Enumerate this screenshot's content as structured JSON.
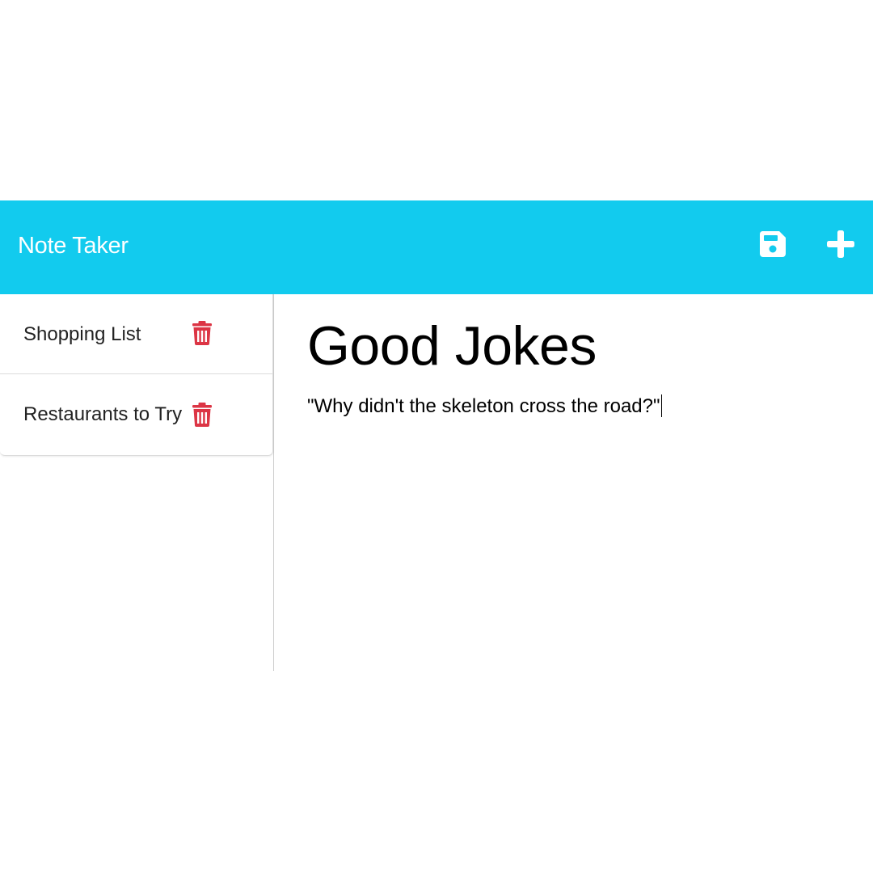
{
  "header": {
    "brand": "Note Taker",
    "save_icon": "floppy-disk-icon",
    "add_icon": "plus-icon",
    "background": "#12cbee"
  },
  "sidebar": {
    "notes": [
      {
        "title": "Shopping List",
        "delete_icon": "trash-icon"
      },
      {
        "title": "Restaurants to Try",
        "delete_icon": "trash-icon"
      }
    ],
    "delete_color": "#dc3545"
  },
  "editor": {
    "title": "Good Jokes",
    "text": "\"Why didn't the skeleton cross the road?\""
  }
}
